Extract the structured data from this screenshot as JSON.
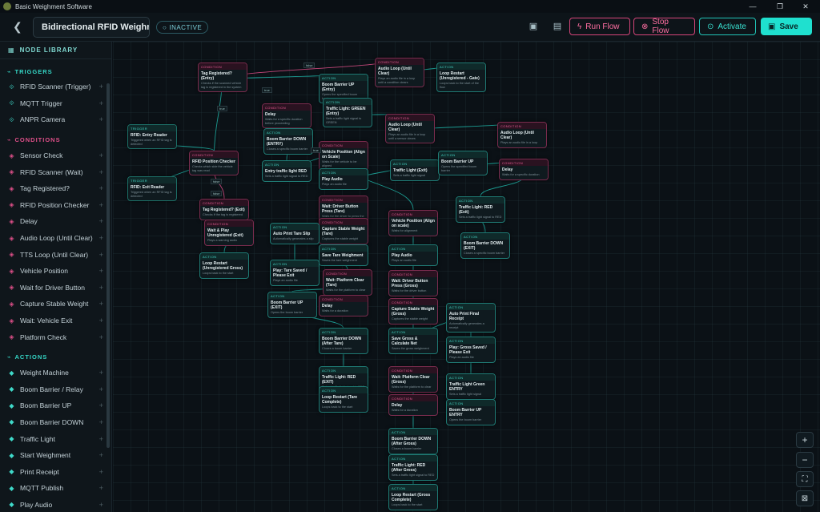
{
  "window": {
    "title": "Basic Weighment Software",
    "minimize": "—",
    "maximize": "❐",
    "close": "✕"
  },
  "header": {
    "flow_name": "Bidirectional RFID Weighm",
    "status": "INACTIVE",
    "run_label": "Run Flow",
    "stop_label": "Stop Flow",
    "activate_label": "Activate",
    "save_label": "Save"
  },
  "sidebar": {
    "title": "NODE LIBRARY",
    "sections": [
      {
        "name": "TRIGGERS",
        "kind": "trigger",
        "items": [
          {
            "label": "RFID Scanner (Trigger)",
            "icon": "rfid-icon"
          },
          {
            "label": "MQTT Trigger",
            "icon": "mqtt-icon"
          },
          {
            "label": "ANPR Camera",
            "icon": "camera-icon"
          }
        ]
      },
      {
        "name": "CONDITIONS",
        "kind": "condition",
        "items": [
          {
            "label": "Sensor Check",
            "icon": "sensor-icon"
          },
          {
            "label": "RFID Scanner (Wait)",
            "icon": "rfid-icon"
          },
          {
            "label": "Tag Registered?",
            "icon": "tag-icon"
          },
          {
            "label": "RFID Position Checker",
            "icon": "position-icon"
          },
          {
            "label": "Delay",
            "icon": "clock-icon"
          },
          {
            "label": "Audio Loop (Until Clear)",
            "icon": "audio-icon"
          },
          {
            "label": "TTS Loop (Until Clear)",
            "icon": "tts-icon"
          },
          {
            "label": "Vehicle Position",
            "icon": "location-icon"
          },
          {
            "label": "Wait for Driver Button",
            "icon": "button-icon"
          },
          {
            "label": "Capture Stable Weight",
            "icon": "scale-icon"
          },
          {
            "label": "Wait: Vehicle Exit",
            "icon": "exit-icon"
          },
          {
            "label": "Platform Check",
            "icon": "platform-icon"
          }
        ]
      },
      {
        "name": "ACTIONS",
        "kind": "action",
        "items": [
          {
            "label": "Weight Machine",
            "icon": "weight-icon"
          },
          {
            "label": "Boom Barrier / Relay",
            "icon": "barrier-icon"
          },
          {
            "label": "Boom Barrier UP",
            "icon": "barrier-up-icon"
          },
          {
            "label": "Boom Barrier DOWN",
            "icon": "barrier-down-icon"
          },
          {
            "label": "Traffic Light",
            "icon": "traffic-light-icon"
          },
          {
            "label": "Start Weighment",
            "icon": "play-icon"
          },
          {
            "label": "Print Receipt",
            "icon": "print-icon"
          },
          {
            "label": "MQTT Publish",
            "icon": "mqtt-icon"
          },
          {
            "label": "Play Audio",
            "icon": "audio-icon"
          }
        ]
      }
    ]
  },
  "nodes": [
    {
      "kind": "cond",
      "type": "CONDITION",
      "title": "Tag Registered? (Entry)",
      "desc": "Checks if the scanned vehicle tag is registered in the system"
    },
    {
      "kind": "cond",
      "type": "CONDITION",
      "title": "Audio Loop (Until Clear)",
      "desc": "Plays an audio file in a loop until a condition clears"
    },
    {
      "kind": "action",
      "type": "ACTION",
      "title": "Loop Restart (Unregistered - Gate)",
      "desc": "Loops back to the start of the flow"
    },
    {
      "kind": "action",
      "type": "ACTION",
      "title": "Boom Barrier UP (Entry)",
      "desc": "Opens the specified boom barrier"
    },
    {
      "kind": "action",
      "type": "ACTION",
      "title": "Traffic Light: GREEN (Entry)",
      "desc": "Sets a traffic light signal to GREEN"
    },
    {
      "kind": "cond",
      "type": "CONDITION",
      "title": "Delay",
      "desc": "Waits for a specific duration before proceeding"
    },
    {
      "kind": "action",
      "type": "ACTION",
      "title": "Boom Barrier DOWN (ENTRY)",
      "desc": "Closes a specific boom barrier"
    },
    {
      "kind": "cond",
      "type": "CONDITION",
      "title": "Audio Loop (Until Clear)",
      "desc": "Plays an audio file in a loop until a sensor clears"
    },
    {
      "kind": "cond",
      "type": "CONDITION",
      "title": "Audio Loop (Until Clear)",
      "desc": "Plays an audio file in a loop"
    },
    {
      "kind": "trig",
      "type": "TRIGGER",
      "title": "RFID: Entry Reader",
      "desc": "Triggered when an RFID tag is detected"
    },
    {
      "kind": "cond",
      "type": "CONDITION",
      "title": "RFID Position Checker",
      "desc": "Checks which side the vehicle tag was read"
    },
    {
      "kind": "action",
      "type": "ACTION",
      "title": "Entry traffic light RED",
      "desc": "Sets a traffic light signal to RED"
    },
    {
      "kind": "cond",
      "type": "CONDITION",
      "title": "Vehicle Position (Align on Scale)",
      "desc": "Waits for the vehicle to be aligned"
    },
    {
      "kind": "action",
      "type": "ACTION",
      "title": "Play Audio",
      "desc": "Plays an audio file"
    },
    {
      "kind": "action",
      "type": "ACTION",
      "title": "Traffic Light (Exit)",
      "desc": "Sets a traffic light signal"
    },
    {
      "kind": "action",
      "type": "ACTION",
      "title": "Boom Barrier UP",
      "desc": "Opens the specified boom barrier"
    },
    {
      "kind": "cond",
      "type": "CONDITION",
      "title": "Delay",
      "desc": "Waits for a specific duration"
    },
    {
      "kind": "trig",
      "type": "TRIGGER",
      "title": "RFID: Exit Reader",
      "desc": "Triggered when an RFID tag is detected"
    },
    {
      "kind": "cond",
      "type": "CONDITION",
      "title": "Tag Registered? (Exit)",
      "desc": "Checks if the tag is registered"
    },
    {
      "kind": "cond",
      "type": "CONDITION",
      "title": "Wait: Driver Button Press (Tare)",
      "desc": "Waits for the driver to press the button"
    },
    {
      "kind": "action",
      "type": "ACTION",
      "title": "Traffic Light: RED (Exit)",
      "desc": "Sets a traffic light signal to RED"
    },
    {
      "kind": "cond",
      "type": "CONDITION",
      "title": "Wait & Play Unregistered (Exit)",
      "desc": "Plays a warning audio"
    },
    {
      "kind": "cond",
      "type": "CONDITION",
      "title": "Capture Stable Weight (Tare)",
      "desc": "Captures the stable weight"
    },
    {
      "kind": "cond",
      "type": "CONDITION",
      "title": "Vehicle Position (Align on scale)",
      "desc": "Waits for alignment"
    },
    {
      "kind": "action",
      "type": "ACTION",
      "title": "Boom Barrier DOWN (EXIT)",
      "desc": "Closes a specific boom barrier"
    },
    {
      "kind": "action",
      "type": "ACTION",
      "title": "Auto Print Tare Slip",
      "desc": "Automatically generates a slip"
    },
    {
      "kind": "action",
      "type": "ACTION",
      "title": "Save Tare Weighment",
      "desc": "Saves the tare weighment"
    },
    {
      "kind": "action",
      "type": "ACTION",
      "title": "Play Audio",
      "desc": "Plays an audio file"
    },
    {
      "kind": "action",
      "type": "ACTION",
      "title": "Loop Restart (Unregistered Gross)",
      "desc": "Loops back to the start"
    },
    {
      "kind": "action",
      "type": "ACTION",
      "title": "Play: Tare Saved / Please Exit",
      "desc": "Plays an audio file"
    },
    {
      "kind": "cond",
      "type": "CONDITION",
      "title": "Wait: Platform Clear (Tare)",
      "desc": "Waits for the platform to clear"
    },
    {
      "kind": "cond",
      "type": "CONDITION",
      "title": "Wait: Driver Button Press (Gross)",
      "desc": "Waits for the driver button"
    },
    {
      "kind": "action",
      "type": "ACTION",
      "title": "Boom Barrier UP (EXIT)",
      "desc": "Opens the boom barrier"
    },
    {
      "kind": "cond",
      "type": "CONDITION",
      "title": "Delay",
      "desc": "Waits for a duration"
    },
    {
      "kind": "cond",
      "type": "CONDITION",
      "title": "Capture Stable Weight (Gross)",
      "desc": "Captures the stable weight"
    },
    {
      "kind": "action",
      "type": "ACTION",
      "title": "Auto Print Final Receipt",
      "desc": "Automatically generates a receipt"
    },
    {
      "kind": "action",
      "type": "ACTION",
      "title": "Traffic Light (Exit)",
      "desc": "Sets a traffic light signal"
    },
    {
      "kind": "action",
      "type": "ACTION",
      "title": "Boom Barrier DOWN (After Tare)",
      "desc": "Closes a boom barrier"
    },
    {
      "kind": "action",
      "type": "ACTION",
      "title": "Save Gross & Calculate Net",
      "desc": "Saves the gross weighment"
    },
    {
      "kind": "action",
      "type": "ACTION",
      "title": "Play: Gross Saved / Please Exit",
      "desc": "Plays an audio file"
    },
    {
      "kind": "action",
      "type": "ACTION",
      "title": "Traffic Light: RED (EXIT)",
      "desc": "Sets a traffic light signal to RED"
    },
    {
      "kind": "cond",
      "type": "CONDITION",
      "title": "Wait: Platform Clear (Gross)",
      "desc": "Waits for the platform to clear"
    },
    {
      "kind": "action",
      "type": "ACTION",
      "title": "Traffic Light Green ENTRY",
      "desc": "Sets a traffic light signal"
    },
    {
      "kind": "action",
      "type": "ACTION",
      "title": "Loop Restart (Tare Complete)",
      "desc": "Loops back to the start"
    },
    {
      "kind": "cond",
      "type": "CONDITION",
      "title": "Delay",
      "desc": "Waits for a duration"
    },
    {
      "kind": "action",
      "type": "ACTION",
      "title": "Boom Barrier UP ENTRY",
      "desc": "Opens the boom barrier"
    },
    {
      "kind": "action",
      "type": "ACTION",
      "title": "Boom Barrier DOWN (After Gross)",
      "desc": "Closes a boom barrier"
    },
    {
      "kind": "action",
      "type": "ACTION",
      "title": "Traffic Light: RED (After Gross)",
      "desc": "Sets a traffic light signal to RED"
    },
    {
      "kind": "action",
      "type": "ACTION",
      "title": "Loop Restart (Gross Complete)",
      "desc": "Loops back to the start"
    }
  ],
  "edge_labels": [
    "true",
    "false",
    "true",
    "false",
    "true",
    "false"
  ],
  "zoom": {
    "in": "+",
    "out": "−"
  },
  "colors": {
    "accent": "#1fe0cf",
    "condition": "#e0508a",
    "action": "#35d6c6",
    "background": "#0b1117"
  }
}
